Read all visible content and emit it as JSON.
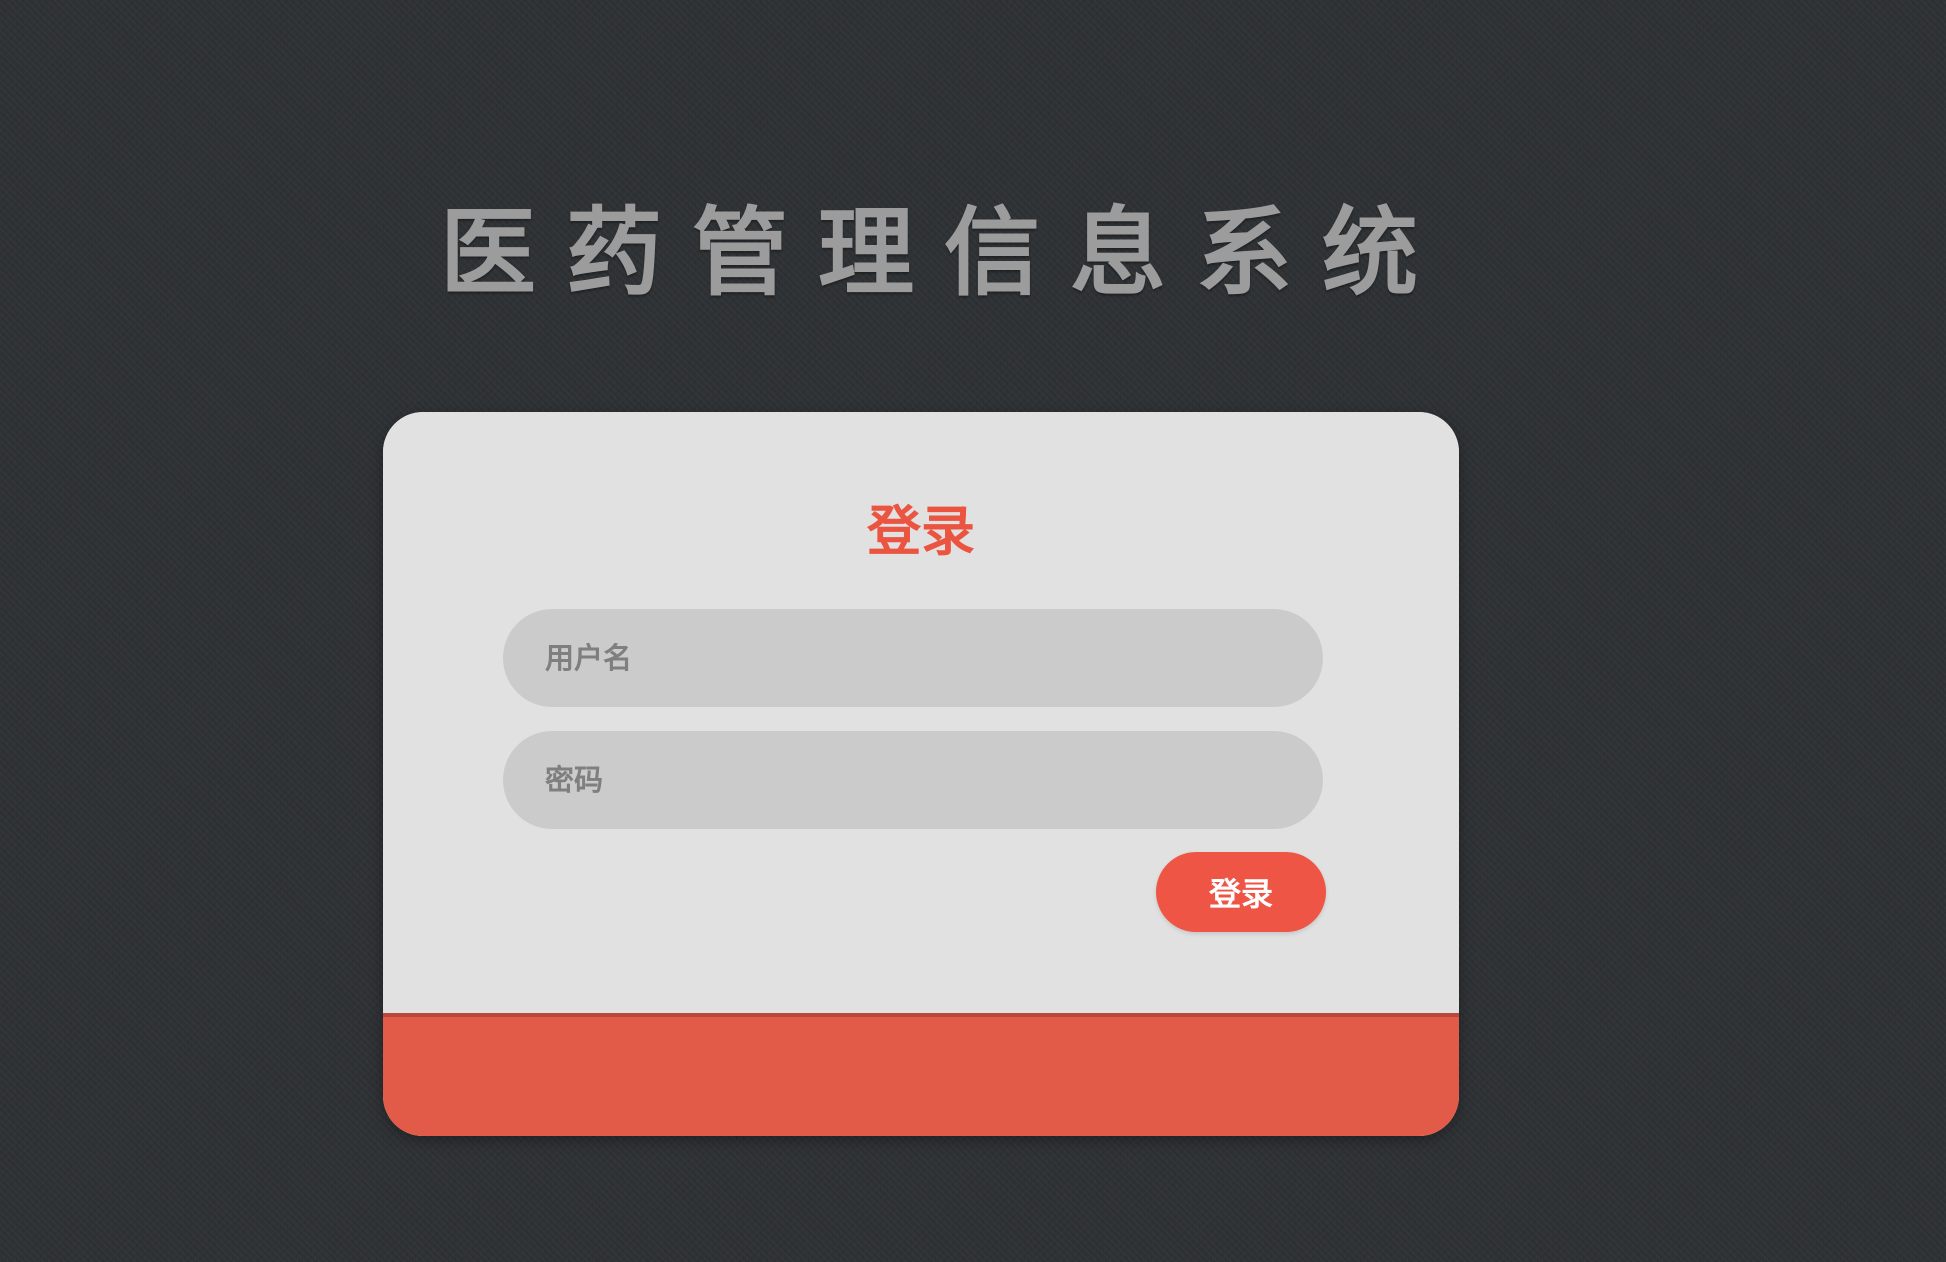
{
  "page": {
    "title": "医药管理信息系统"
  },
  "login_form": {
    "heading": "登录",
    "username_placeholder": "用户名",
    "username_value": "",
    "password_placeholder": "密码",
    "password_value": "",
    "submit_label": "登录"
  },
  "colors": {
    "background": "#2e3134",
    "card": "#e1e1e1",
    "input": "#cbcbcb",
    "accent": "#ea5440",
    "footer": "#e25b49",
    "title_text": "#9c9c9c"
  }
}
